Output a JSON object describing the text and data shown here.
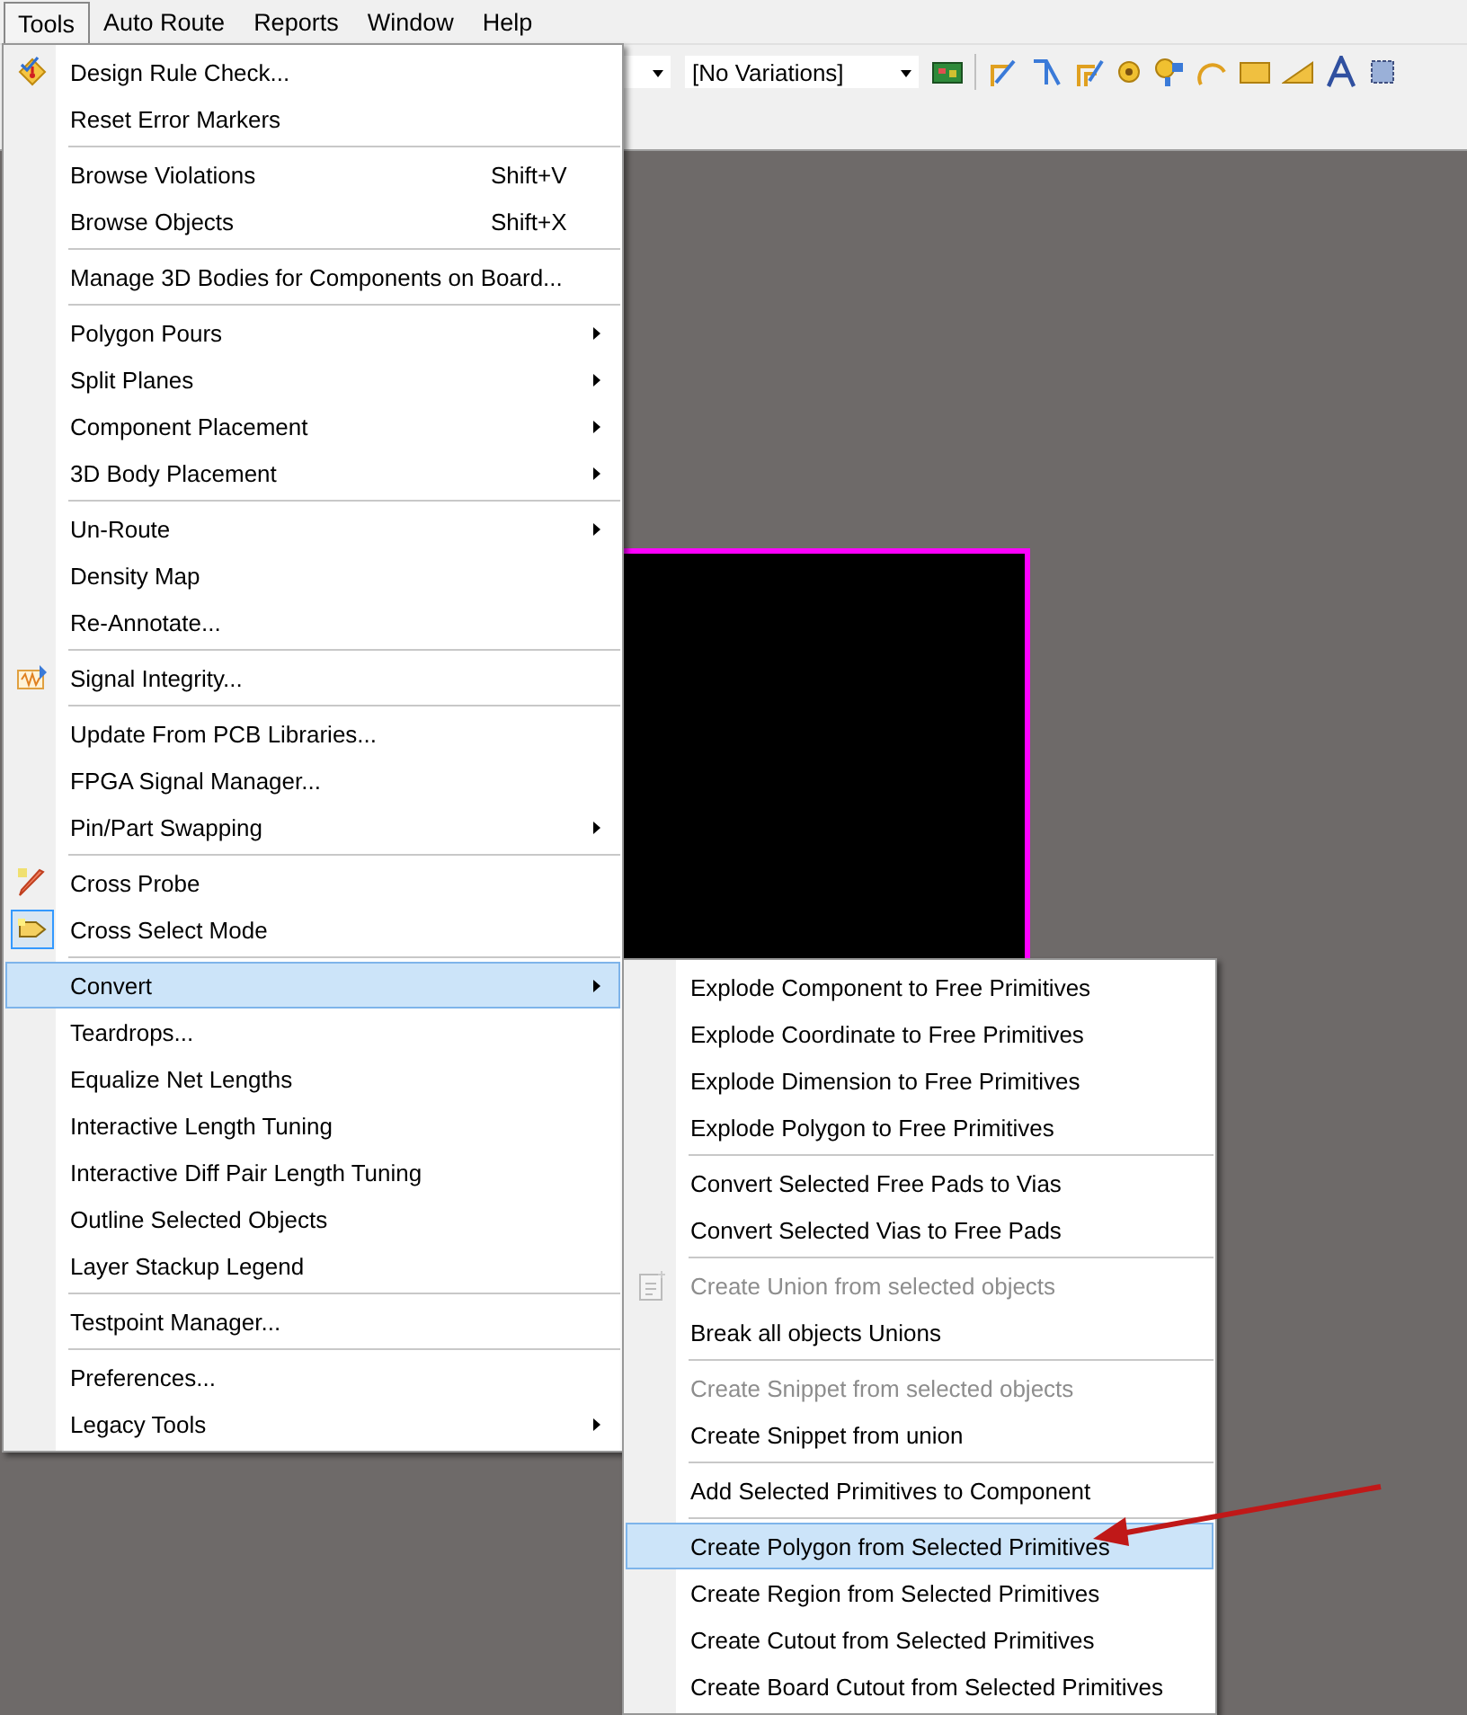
{
  "menu_bar": [
    {
      "label": "Tools",
      "selected": true
    },
    {
      "label": "Auto Route",
      "selected": false
    },
    {
      "label": "Reports",
      "selected": false
    },
    {
      "label": "Window",
      "selected": false
    },
    {
      "label": "Help",
      "selected": false
    }
  ],
  "toolbar": {
    "variant_dropdown": "[No Variations]"
  },
  "tools_menu": {
    "groups": [
      [
        {
          "label": "Design Rule Check...",
          "submenu": false,
          "selected": false,
          "checked": false
        },
        {
          "label": "Reset Error Markers",
          "submenu": false,
          "selected": false,
          "checked": false
        }
      ],
      [
        {
          "label": "Browse Violations",
          "shortcut": "Shift+V",
          "submenu": false,
          "selected": false,
          "checked": false
        },
        {
          "label": "Browse Objects",
          "shortcut": "Shift+X",
          "submenu": false,
          "selected": false,
          "checked": false
        }
      ],
      [
        {
          "label": "Manage 3D Bodies for Components on Board...",
          "submenu": false,
          "selected": false,
          "checked": false
        }
      ],
      [
        {
          "label": "Polygon Pours",
          "submenu": true,
          "selected": false,
          "checked": false
        },
        {
          "label": "Split Planes",
          "submenu": true,
          "selected": false,
          "checked": false
        },
        {
          "label": "Component Placement",
          "submenu": true,
          "selected": false,
          "checked": false
        },
        {
          "label": "3D Body Placement",
          "submenu": true,
          "selected": false,
          "checked": false
        }
      ],
      [
        {
          "label": "Un-Route",
          "submenu": true,
          "selected": false,
          "checked": false
        },
        {
          "label": "Density Map",
          "submenu": false,
          "selected": false,
          "checked": false
        },
        {
          "label": "Re-Annotate...",
          "submenu": false,
          "selected": false,
          "checked": false
        }
      ],
      [
        {
          "label": "Signal Integrity...",
          "submenu": false,
          "selected": false,
          "checked": false
        }
      ],
      [
        {
          "label": "Update From PCB Libraries...",
          "submenu": false,
          "selected": false,
          "checked": false
        },
        {
          "label": "FPGA Signal Manager...",
          "submenu": false,
          "selected": false,
          "checked": false
        },
        {
          "label": "Pin/Part Swapping",
          "submenu": true,
          "selected": false,
          "checked": false
        }
      ],
      [
        {
          "label": "Cross Probe",
          "submenu": false,
          "selected": false,
          "checked": false
        },
        {
          "label": "Cross Select Mode",
          "submenu": false,
          "selected": false,
          "checked": true
        }
      ],
      [
        {
          "label": "Convert",
          "submenu": true,
          "selected": true,
          "checked": false
        },
        {
          "label": "Teardrops...",
          "submenu": false,
          "selected": false,
          "checked": false
        },
        {
          "label": "Equalize Net Lengths",
          "submenu": false,
          "selected": false,
          "checked": false
        },
        {
          "label": "Interactive Length Tuning",
          "submenu": false,
          "selected": false,
          "checked": false
        },
        {
          "label": "Interactive Diff Pair Length Tuning",
          "submenu": false,
          "selected": false,
          "checked": false
        },
        {
          "label": "Outline Selected Objects",
          "submenu": false,
          "selected": false,
          "checked": false
        },
        {
          "label": "Layer Stackup Legend",
          "submenu": false,
          "selected": false,
          "checked": false
        }
      ],
      [
        {
          "label": "Testpoint Manager...",
          "submenu": false,
          "selected": false,
          "checked": false
        }
      ],
      [
        {
          "label": "Preferences...",
          "submenu": false,
          "selected": false,
          "checked": false
        },
        {
          "label": "Legacy Tools",
          "submenu": true,
          "selected": false,
          "checked": false
        }
      ]
    ]
  },
  "convert_menu": {
    "groups": [
      [
        {
          "label": "Explode Component to Free Primitives",
          "selected": false,
          "disabled": false
        },
        {
          "label": "Explode Coordinate to Free Primitives",
          "selected": false,
          "disabled": false
        },
        {
          "label": "Explode Dimension to Free Primitives",
          "selected": false,
          "disabled": false
        },
        {
          "label": "Explode Polygon to Free Primitives",
          "selected": false,
          "disabled": false
        }
      ],
      [
        {
          "label": "Convert Selected Free Pads to Vias",
          "selected": false,
          "disabled": false
        },
        {
          "label": "Convert Selected Vias to Free Pads",
          "selected": false,
          "disabled": false
        }
      ],
      [
        {
          "label": "Create Union from selected objects",
          "selected": false,
          "disabled": true
        },
        {
          "label": "Break all objects Unions",
          "selected": false,
          "disabled": false
        }
      ],
      [
        {
          "label": "Create Snippet from selected objects",
          "selected": false,
          "disabled": true
        },
        {
          "label": "Create Snippet from union",
          "selected": false,
          "disabled": false
        }
      ],
      [
        {
          "label": "Add Selected Primitives to Component",
          "selected": false,
          "disabled": false
        }
      ],
      [
        {
          "label": "Create Polygon from Selected Primitives",
          "selected": true,
          "disabled": false
        },
        {
          "label": "Create Region from Selected Primitives",
          "selected": false,
          "disabled": false
        },
        {
          "label": "Create Cutout from Selected Primitives",
          "selected": false,
          "disabled": false
        },
        {
          "label": "Create Board Cutout from Selected Primitives",
          "selected": false,
          "disabled": false
        }
      ]
    ]
  }
}
